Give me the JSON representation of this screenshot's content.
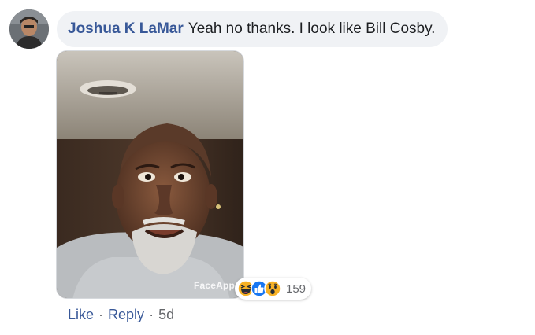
{
  "comment": {
    "author": "Joshua K LaMar",
    "text": "Yeah no thanks. I look like Bill Cosby.",
    "photo_watermark": "FaceApp",
    "reactions": {
      "icons": [
        "haha-icon",
        "like-icon",
        "wow-icon"
      ],
      "count": "159"
    },
    "actions": {
      "like": "Like",
      "reply": "Reply",
      "separator": "·",
      "timestamp": "5d"
    }
  },
  "colors": {
    "link": "#385898",
    "bubble": "#f0f2f5",
    "muted": "#65676b"
  }
}
